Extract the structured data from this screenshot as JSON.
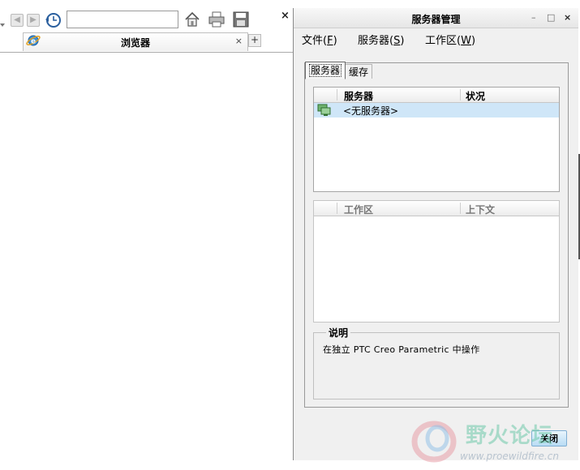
{
  "browser": {
    "url_value": "",
    "tab_label": "浏览器",
    "tab_close_glyph": "×",
    "tab_add_glyph": "+",
    "close_glyph": "×",
    "icons": [
      "dropdown-arrow-icon",
      "back-icon",
      "forward-icon",
      "history-icon",
      "home-icon",
      "print-icon",
      "save-icon",
      "browser-tab-icon"
    ]
  },
  "dialog": {
    "title": "服务器管理",
    "minimize_glyph": "–",
    "maximize_glyph": "□",
    "close_glyph": "×",
    "menu": [
      {
        "text": "文件",
        "key": "F"
      },
      {
        "text": "服务器",
        "key": "S"
      },
      {
        "text": "工作区",
        "key": "W"
      }
    ],
    "tabs": [
      {
        "label": "服务器",
        "selected": true
      },
      {
        "label": "缓存",
        "selected": false
      }
    ],
    "servers_table": {
      "columns": [
        "服务器",
        "状况"
      ],
      "rows": [
        {
          "name": "<无服务器>",
          "status": "",
          "selected": true
        }
      ]
    },
    "workspace_table": {
      "columns": [
        "工作区",
        "上下文"
      ],
      "rows": []
    },
    "description": {
      "legend": "说明",
      "text": "在独立 PTC Creo Parametric 中操作"
    },
    "close_button": "关闭"
  },
  "watermark": {
    "text": "野火论坛",
    "url": "www.proewildfire.cn"
  },
  "colors": {
    "selection": "#cfe6f8",
    "dialog_bg": "#f0f0f0",
    "button_accent": "#b8dcf4"
  }
}
